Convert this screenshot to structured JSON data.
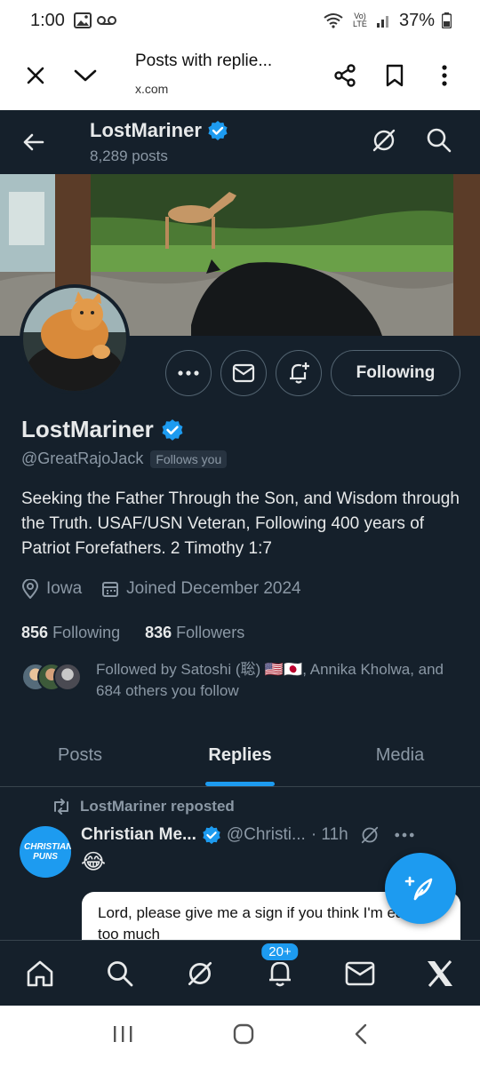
{
  "status_bar": {
    "time": "1:00",
    "network_label": "Vo) LTE",
    "battery": "37%"
  },
  "browser": {
    "title": "Posts with replie...",
    "url": "x.com"
  },
  "header": {
    "display_name": "LostMariner",
    "post_count": "8,289 posts"
  },
  "profile": {
    "display_name": "LostMariner",
    "handle": "@GreatRajoJack",
    "follows_you": "Follows you",
    "following_button": "Following",
    "bio": "Seeking the Father Through the Son, and Wisdom through the Truth. USAF/USN Veteran, Following 400 years of Patriot Forefathers. 2 Timothy 1:7",
    "location": "Iowa",
    "joined": "Joined December 2024",
    "following_count": "856",
    "following_label": "Following",
    "followers_count": "836",
    "followers_label": "Followers",
    "followed_by": "Followed by Satoshi (聡) 🇺🇸🇯🇵, Annika Kholwa, and 684 others you follow"
  },
  "tabs": [
    {
      "label": "Posts",
      "active": false
    },
    {
      "label": "Replies",
      "active": true
    },
    {
      "label": "Media",
      "active": false
    }
  ],
  "tweet": {
    "repost_label": "LostMariner reposted",
    "author_name": "Christian Me...",
    "author_handle": "@Christi...",
    "time": "· 11h",
    "avatar_text": "CHRISTIAN PUNS",
    "emoji": "😂",
    "quote_text": "Lord, please give me a sign if you think I'm eating too much"
  },
  "bottom_nav": {
    "notifications_badge": "20+"
  },
  "colors": {
    "background": "#15202b",
    "accent": "#1d9bf0",
    "verified": "#1d9bf0",
    "secondary_text": "#8b98a5"
  }
}
